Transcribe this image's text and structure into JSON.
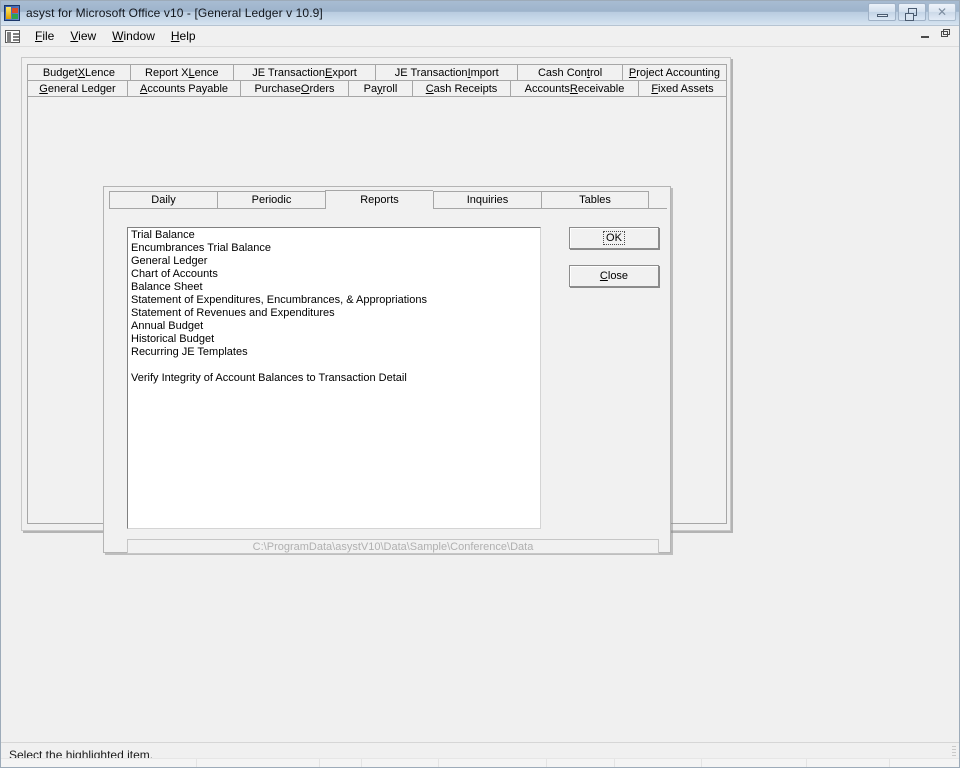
{
  "window": {
    "title": "asyst for Microsoft Office v10 - [General Ledger   v 10.9]",
    "app_icon": "app-icon",
    "caption_buttons": {
      "minimize": "minimize-icon",
      "restore": "restore-icon",
      "close": "close-icon"
    },
    "mdi_child_buttons": {
      "minimize": "mdi-minimize-icon",
      "restore": "mdi-restore-icon"
    }
  },
  "menubar": {
    "system_icon": "mdi-system-menu-icon",
    "items": [
      {
        "label": "File",
        "accel": "F"
      },
      {
        "label": "View",
        "accel": "V"
      },
      {
        "label": "Window",
        "accel": "W"
      },
      {
        "label": "Help",
        "accel": "H"
      }
    ]
  },
  "module_tabs": {
    "row1": [
      {
        "label": "Budget XLence",
        "accel": "X",
        "selected": false
      },
      {
        "label": "Report XLence",
        "accel": "L",
        "selected": false
      },
      {
        "label": "JE Transaction Export",
        "accel": "E",
        "selected": false
      },
      {
        "label": "JE Transaction Import",
        "accel": "I",
        "selected": false
      },
      {
        "label": "Cash Control",
        "accel": "t",
        "selected": false
      },
      {
        "label": "Project Accounting",
        "accel": "P",
        "selected": false
      }
    ],
    "row2": [
      {
        "label": "General Ledger",
        "accel": "G",
        "selected": true
      },
      {
        "label": "Accounts Payable",
        "accel": "A",
        "selected": false
      },
      {
        "label": "Purchase Orders",
        "accel": "O",
        "selected": false
      },
      {
        "label": "Payroll",
        "accel": "y",
        "selected": false
      },
      {
        "label": "Cash Receipts",
        "accel": "C",
        "selected": false
      },
      {
        "label": "Accounts Receivable",
        "accel": "R",
        "selected": false
      },
      {
        "label": "Fixed Assets",
        "accel": "F",
        "selected": false
      }
    ]
  },
  "function_tabs": [
    {
      "label": "Daily",
      "selected": false
    },
    {
      "label": "Periodic",
      "selected": false
    },
    {
      "label": "Reports",
      "selected": true
    },
    {
      "label": "Inquiries",
      "selected": false
    },
    {
      "label": "Tables",
      "selected": false
    }
  ],
  "report_list": {
    "items": [
      "Trial Balance",
      "Encumbrances Trial Balance",
      "General Ledger",
      "Chart of Accounts",
      "Balance Sheet",
      "Statement of Expenditures, Encumbrances, & Appropriations",
      "Statement of Revenues and Expenditures",
      "Annual Budget",
      "Historical Budget",
      "Recurring JE Templates",
      "",
      "Verify Integrity of Account Balances to Transaction Detail"
    ]
  },
  "buttons": {
    "ok": {
      "label": "OK",
      "focused": true
    },
    "close": {
      "label": "Close",
      "accel": "C",
      "focused": false
    }
  },
  "path_field": {
    "value": "C:\\ProgramData\\asystV10\\Data\\Sample\\Conference\\Data"
  },
  "statusbar": {
    "message": "Select the highlighted item."
  }
}
